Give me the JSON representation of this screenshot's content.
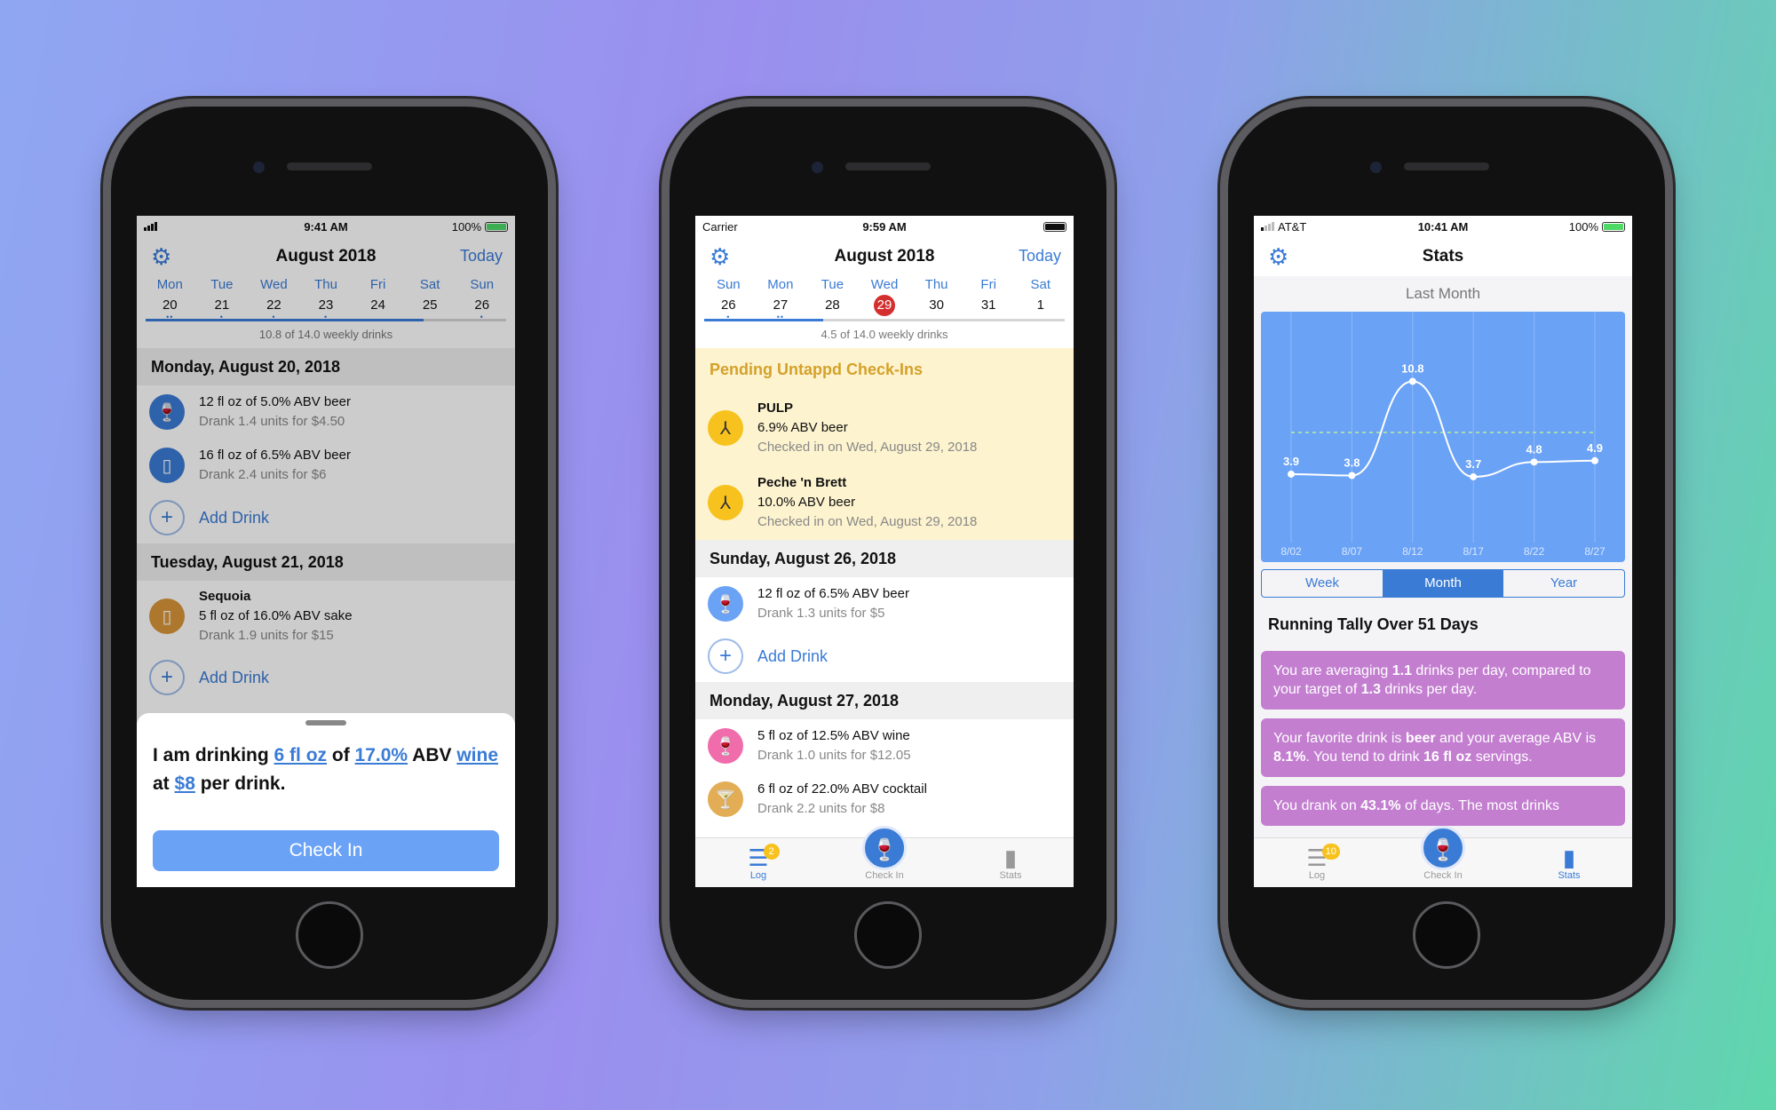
{
  "phone1": {
    "status": {
      "time": "9:41 AM",
      "battery": "100%"
    },
    "nav": {
      "title": "August 2018",
      "today": "Today"
    },
    "days": [
      [
        "Mon",
        "20",
        "••"
      ],
      [
        "Tue",
        "21",
        "•"
      ],
      [
        "Wed",
        "22",
        "•"
      ],
      [
        "Thu",
        "23",
        "•"
      ],
      [
        "Fri",
        "24",
        ""
      ],
      [
        "Sat",
        "25",
        ""
      ],
      [
        "Sun",
        "26",
        "•"
      ]
    ],
    "progress": 0.77,
    "weekly": "10.8 of 14.0 weekly drinks",
    "sec1": "Monday, August 20, 2018",
    "r1a": "12 fl oz of 5.0% ABV beer",
    "r1b": "Drank 1.4 units for $4.50",
    "r2a": "16 fl oz of 6.5% ABV beer",
    "r2b": "Drank 2.4 units for $6",
    "add": "Add Drink",
    "sec2": "Tuesday, August 21, 2018",
    "r3n": "Sequoia",
    "r3a": "5 fl oz of 16.0% ABV sake",
    "r3b": "Drank 1.9 units for $15",
    "sheet": {
      "p1": "I am drinking ",
      "size": "6 fl oz",
      "p2": " of ",
      "abv": "17.0%",
      "p3": " ABV ",
      "type": "wine",
      "p4": " at ",
      "price": "$8",
      "p5": " per drink.",
      "button": "Check In"
    }
  },
  "phone2": {
    "status": {
      "carrier": "Carrier",
      "time": "9:59 AM"
    },
    "nav": {
      "title": "August 2018",
      "today": "Today"
    },
    "days": [
      [
        "Sun",
        "26",
        "•"
      ],
      [
        "Mon",
        "27",
        "••"
      ],
      [
        "Tue",
        "28",
        ""
      ],
      [
        "Wed",
        "29",
        ""
      ],
      [
        "Thu",
        "30",
        ""
      ],
      [
        "Fri",
        "31",
        ""
      ],
      [
        "Sat",
        "1",
        ""
      ]
    ],
    "progress": 0.33,
    "weekly": "4.5 of 14.0 weekly drinks",
    "pending": "Pending Untappd Check-Ins",
    "p1n": "PULP",
    "p1a": "6.9% ABV beer",
    "p1b": "Checked in on Wed, August 29, 2018",
    "p2n": "Peche 'n Brett",
    "p2a": "10.0% ABV beer",
    "p2b": "Checked in on Wed, August 29, 2018",
    "sec1": "Sunday, August 26, 2018",
    "r1a": "12 fl oz of 6.5% ABV beer",
    "r1b": "Drank 1.3 units for $5",
    "add": "Add Drink",
    "sec2": "Monday, August 27, 2018",
    "r2a": "5 fl oz of 12.5% ABV wine",
    "r2b": "Drank 1.0 units for $12.05",
    "r3a": "6 fl oz of 22.0% ABV cocktail",
    "r3b": "Drank 2.2 units for $8",
    "tabs": {
      "log": "Log",
      "badge": "2",
      "check": "Check In",
      "stats": "Stats"
    }
  },
  "phone3": {
    "status": {
      "carrier": "AT&T",
      "time": "10:41 AM",
      "battery": "100%"
    },
    "nav": {
      "title": "Stats"
    },
    "period": "Last Month",
    "chart_data": {
      "type": "line",
      "x": [
        "8/02",
        "8/07",
        "8/12",
        "8/17",
        "8/22",
        "8/27"
      ],
      "values": [
        3.9,
        3.8,
        10.8,
        3.7,
        4.8,
        4.9
      ],
      "target": 7.0,
      "ylim": [
        0,
        14
      ]
    },
    "seg": [
      "Week",
      "Month",
      "Year"
    ],
    "tally": "Running Tally Over 51 Days",
    "c1": {
      "a": "You are averaging ",
      "b": "1.1",
      "c": " drinks per day, compared to your target of ",
      "d": "1.3",
      "e": " drinks per day."
    },
    "c2": {
      "a": "Your favorite drink is ",
      "b": "beer",
      "c": " and your average ABV is ",
      "d": "8.1%",
      "e": ". You tend to drink ",
      "f": "16 fl oz",
      "g": " servings."
    },
    "c3": {
      "a": "You drank on ",
      "b": "43.1%",
      "c": " of days. The most drinks"
    },
    "tabs": {
      "log": "Log",
      "badge": "10",
      "check": "Check In",
      "stats": "Stats"
    }
  },
  "colors": {
    "accent": "#3a7bd5",
    "chart": "#6aa2f6",
    "card": "#c37ed0",
    "pending": "#fdf3cf"
  }
}
